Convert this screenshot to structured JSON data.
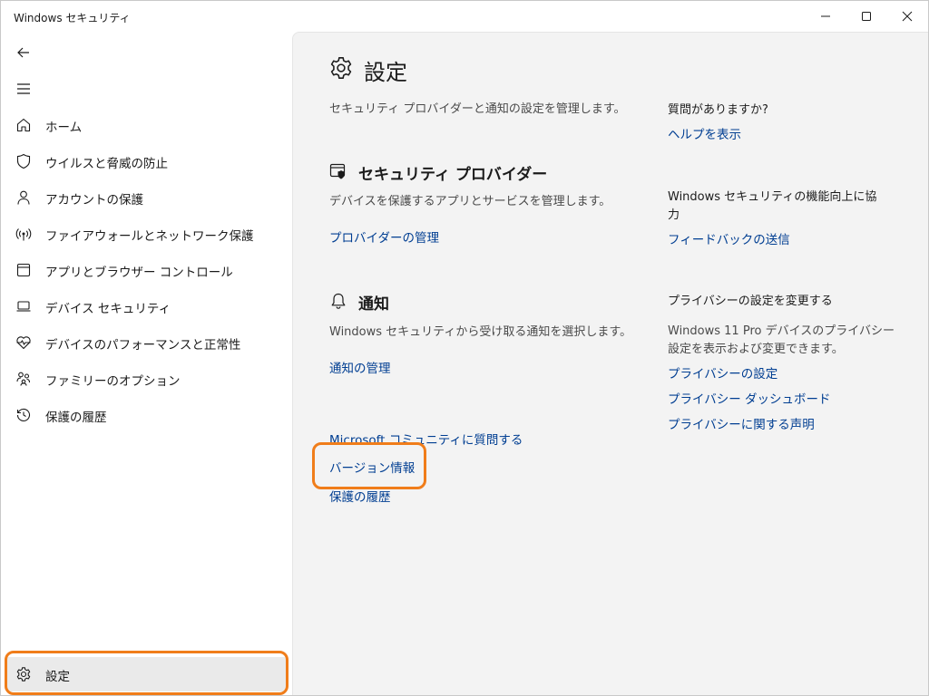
{
  "window": {
    "title": "Windows セキュリティ"
  },
  "sidebar": {
    "items": [
      {
        "label": "ホーム",
        "icon": "home-icon"
      },
      {
        "label": "ウイルスと脅威の防止",
        "icon": "shield-icon"
      },
      {
        "label": "アカウントの保護",
        "icon": "person-icon"
      },
      {
        "label": "ファイアウォールとネットワーク保護",
        "icon": "wireless-icon"
      },
      {
        "label": "アプリとブラウザー コントロール",
        "icon": "app-window-icon"
      },
      {
        "label": "デバイス セキュリティ",
        "icon": "laptop-icon"
      },
      {
        "label": "デバイスのパフォーマンスと正常性",
        "icon": "heart-pulse-icon"
      },
      {
        "label": "ファミリーのオプション",
        "icon": "family-icon"
      },
      {
        "label": "保護の履歴",
        "icon": "history-icon"
      }
    ],
    "settings_label": "設定"
  },
  "main": {
    "title": "設定",
    "description": "セキュリティ プロバイダーと通知の設定を管理します。",
    "providers": {
      "heading": "セキュリティ プロバイダー",
      "description": "デバイスを保護するアプリとサービスを管理します。",
      "link": "プロバイダーの管理"
    },
    "notifications": {
      "heading": "通知",
      "description": "Windows セキュリティから受け取る通知を選択します。",
      "link": "通知の管理"
    },
    "bottom_links": {
      "community": "Microsoft コミュニティに質問する",
      "version": "バージョン情報",
      "history": "保護の履歴"
    }
  },
  "right": {
    "question": {
      "heading": "質問がありますか?",
      "link": "ヘルプを表示"
    },
    "improve": {
      "text_line1": "Windows セキュリティの機能向上に協",
      "text_line2": "力",
      "link": "フィードバックの送信"
    },
    "privacy": {
      "heading": "プライバシーの設定を変更する",
      "text_line1": "Windows 11 Pro デバイスのプライバシー",
      "text_line2": "設定を表示および変更できます。",
      "link1": "プライバシーの設定",
      "link2": "プライバシー ダッシュボード",
      "link3": "プライバシーに関する声明"
    }
  },
  "colors": {
    "accent": "#0067c0",
    "link": "#003e92",
    "highlight": "#f07d1a",
    "content_bg": "#f3f3f3"
  }
}
